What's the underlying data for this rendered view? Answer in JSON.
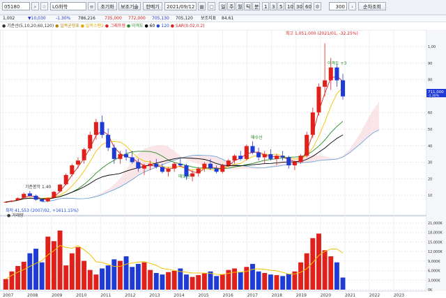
{
  "toolbar": {
    "code": "05180",
    "name": "LG화학",
    "opt_yield": "초기화",
    "opt_correct": "보조기술",
    "opt_add": "한메기",
    "date": "2021/09/12",
    "periods": [
      "일",
      "주",
      "월",
      "틱",
      "분"
    ],
    "minutes": [
      "1",
      "3",
      "5",
      "10",
      "30",
      "60"
    ],
    "count": "300",
    "show_label": "순차조회"
  },
  "infobar": {
    "period": "1,002",
    "v1": "▼10,030",
    "v2": "-1.30%",
    "v3": "786,216",
    "v4": "735,000",
    "v5": "772,000",
    "v6": "705,130",
    "v7": "705,120",
    "v8": "보조지표",
    "v9": "84.61"
  },
  "legend": {
    "ma": "● 기준선(5,10,20,60,120)",
    "ichi": "● 일목균형표",
    "sar": "● 일목스팬2",
    "bb": "● 그래프형",
    "envelope": "● 이격도",
    "pma": "● 60",
    "psar": "● 120",
    "param": "● SAR(0.02,0.2)"
  },
  "vol_legend": "● 거래량",
  "annotations": {
    "high": "최고 1,051,000 (2021/01, -32.25%)",
    "low": "최저 41,553 (2007/02, +1611.15%)",
    "a1": "기준봉악 1.40",
    "a2": "이격도 +3",
    "a3": "매수선",
    "a4": "매도선"
  },
  "current_price": "711,000",
  "current_price_sub": "-1.30%",
  "chart_data": {
    "type": "candlestick",
    "x": [
      "2007",
      "2008",
      "2009",
      "2010",
      "2011",
      "2012",
      "2013",
      "2014",
      "2015",
      "2016",
      "2017",
      "2018",
      "2019",
      "2020",
      "2021",
      "2022",
      "2023"
    ],
    "price_ticks": [
      "1,000000",
      "900000",
      "800000",
      "700000",
      "600000",
      "500000",
      "400000",
      "300000",
      "200000",
      "100000"
    ],
    "volume_ticks": [
      "21,000K",
      "18,000K",
      "15,000K",
      "12,000K",
      "9,000K",
      "6,000K",
      "3,000K",
      "0K"
    ],
    "price_ylim": [
      0,
      1100000
    ],
    "volume_ylim": [
      0,
      22000
    ],
    "candles": [
      [
        60000,
        66000,
        55000,
        62000
      ],
      [
        64000,
        72000,
        60000,
        70000
      ],
      [
        72000,
        90000,
        68000,
        85000
      ],
      [
        88000,
        120000,
        84000,
        112000
      ],
      [
        115000,
        130000,
        98000,
        100000
      ],
      [
        100000,
        108000,
        70000,
        76000
      ],
      [
        78000,
        82000,
        62000,
        66000
      ],
      [
        66000,
        90000,
        60000,
        86000
      ],
      [
        88000,
        130000,
        84000,
        125000
      ],
      [
        128000,
        175000,
        120000,
        170000
      ],
      [
        172000,
        240000,
        165000,
        230000
      ],
      [
        235000,
        300000,
        220000,
        290000
      ],
      [
        295000,
        340000,
        270000,
        320000
      ],
      [
        322000,
        400000,
        300000,
        390000
      ],
      [
        395000,
        500000,
        380000,
        480000
      ],
      [
        480000,
        580000,
        450000,
        560000
      ],
      [
        560000,
        600000,
        460000,
        480000
      ],
      [
        480000,
        520000,
        380000,
        400000
      ],
      [
        400000,
        420000,
        300000,
        330000
      ],
      [
        330000,
        380000,
        300000,
        360000
      ],
      [
        360000,
        390000,
        320000,
        340000
      ],
      [
        340000,
        380000,
        300000,
        310000
      ],
      [
        310000,
        330000,
        250000,
        270000
      ],
      [
        270000,
        300000,
        230000,
        290000
      ],
      [
        290000,
        320000,
        260000,
        300000
      ],
      [
        300000,
        330000,
        270000,
        280000
      ],
      [
        280000,
        300000,
        240000,
        250000
      ],
      [
        250000,
        280000,
        220000,
        270000
      ],
      [
        270000,
        310000,
        250000,
        300000
      ],
      [
        300000,
        330000,
        280000,
        290000
      ],
      [
        290000,
        300000,
        200000,
        220000
      ],
      [
        220000,
        260000,
        190000,
        240000
      ],
      [
        240000,
        280000,
        220000,
        270000
      ],
      [
        270000,
        310000,
        250000,
        300000
      ],
      [
        300000,
        330000,
        260000,
        270000
      ],
      [
        270000,
        290000,
        240000,
        250000
      ],
      [
        250000,
        300000,
        240000,
        290000
      ],
      [
        290000,
        330000,
        280000,
        320000
      ],
      [
        320000,
        360000,
        300000,
        350000
      ],
      [
        350000,
        380000,
        320000,
        330000
      ],
      [
        330000,
        420000,
        320000,
        410000
      ],
      [
        410000,
        440000,
        360000,
        370000
      ],
      [
        370000,
        400000,
        320000,
        340000
      ],
      [
        340000,
        380000,
        300000,
        360000
      ],
      [
        360000,
        390000,
        320000,
        330000
      ],
      [
        330000,
        360000,
        290000,
        350000
      ],
      [
        350000,
        380000,
        320000,
        340000
      ],
      [
        340000,
        350000,
        270000,
        290000
      ],
      [
        290000,
        320000,
        260000,
        310000
      ],
      [
        310000,
        360000,
        300000,
        350000
      ],
      [
        350000,
        500000,
        340000,
        480000
      ],
      [
        480000,
        650000,
        460000,
        620000
      ],
      [
        620000,
        800000,
        600000,
        780000
      ],
      [
        780000,
        1051000,
        720000,
        820000
      ],
      [
        820000,
        960000,
        760000,
        900000
      ],
      [
        900000,
        920000,
        780000,
        820000
      ],
      [
        820000,
        860000,
        700000,
        720000
      ]
    ],
    "volumes": [
      3500,
      6000,
      7800,
      9200,
      12000,
      13500,
      9000,
      17500,
      16000,
      19500,
      8000,
      12000,
      14000,
      9500,
      6500,
      5000,
      7000,
      8000,
      10000,
      9500,
      11000,
      7500,
      8500,
      9000,
      6500,
      5500,
      5000,
      5800,
      6200,
      7000,
      5000,
      4200,
      4800,
      5500,
      6000,
      4500,
      5000,
      6500,
      7000,
      5800,
      7500,
      8500,
      6000,
      5500,
      5000,
      4800,
      4500,
      5200,
      6000,
      9000,
      12000,
      17000,
      18500,
      13000,
      11000,
      9000,
      4000
    ]
  }
}
